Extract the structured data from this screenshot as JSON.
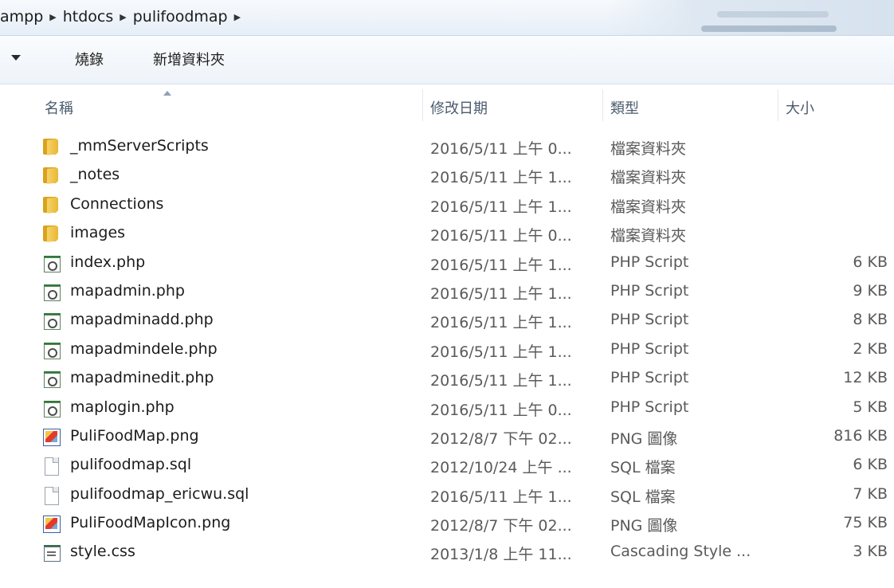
{
  "address_bar": {
    "crumbs": [
      "ampp",
      "htdocs",
      "pulifoodmap"
    ]
  },
  "toolbar": {
    "burn_label": "燒錄",
    "new_folder_label": "新增資料夾"
  },
  "columns": {
    "name": "名稱",
    "date_modified": "修改日期",
    "type": "類型",
    "size": "大小"
  },
  "files": [
    {
      "name": "_mmServerScripts",
      "date": "2016/5/11 上午 0...",
      "type": "檔案資料夾",
      "size": "",
      "icon": "folder-icon"
    },
    {
      "name": "_notes",
      "date": "2016/5/11 上午 1...",
      "type": "檔案資料夾",
      "size": "",
      "icon": "folder-icon"
    },
    {
      "name": "Connections",
      "date": "2016/5/11 上午 1...",
      "type": "檔案資料夾",
      "size": "",
      "icon": "folder-icon"
    },
    {
      "name": "images",
      "date": "2016/5/11 上午 0...",
      "type": "檔案資料夾",
      "size": "",
      "icon": "folder-icon"
    },
    {
      "name": "index.php",
      "date": "2016/5/11 上午 1...",
      "type": "PHP Script",
      "size": "6 KB",
      "icon": "php-file-icon"
    },
    {
      "name": "mapadmin.php",
      "date": "2016/5/11 上午 1...",
      "type": "PHP Script",
      "size": "9 KB",
      "icon": "php-file-icon"
    },
    {
      "name": "mapadminadd.php",
      "date": "2016/5/11 上午 1...",
      "type": "PHP Script",
      "size": "8 KB",
      "icon": "php-file-icon"
    },
    {
      "name": "mapadmindele.php",
      "date": "2016/5/11 上午 1...",
      "type": "PHP Script",
      "size": "2 KB",
      "icon": "php-file-icon"
    },
    {
      "name": "mapadminedit.php",
      "date": "2016/5/11 上午 1...",
      "type": "PHP Script",
      "size": "12 KB",
      "icon": "php-file-icon"
    },
    {
      "name": "maplogin.php",
      "date": "2016/5/11 上午 0...",
      "type": "PHP Script",
      "size": "5 KB",
      "icon": "php-file-icon"
    },
    {
      "name": "PuliFoodMap.png",
      "date": "2012/8/7 下午 02...",
      "type": "PNG 圖像",
      "size": "816 KB",
      "icon": "png-image-icon"
    },
    {
      "name": "pulifoodmap.sql",
      "date": "2012/10/24 上午 ...",
      "type": "SQL 檔案",
      "size": "6 KB",
      "icon": "sql-file-icon"
    },
    {
      "name": "pulifoodmap_ericwu.sql",
      "date": "2016/5/11 上午 1...",
      "type": "SQL 檔案",
      "size": "7 KB",
      "icon": "sql-file-icon"
    },
    {
      "name": "PuliFoodMapIcon.png",
      "date": "2012/8/7 下午 02...",
      "type": "PNG 圖像",
      "size": "75 KB",
      "icon": "png-image-icon"
    },
    {
      "name": "style.css",
      "date": "2013/1/8 上午 11...",
      "type": "Cascading Style ...",
      "size": "3 KB",
      "icon": "css-file-icon"
    }
  ]
}
